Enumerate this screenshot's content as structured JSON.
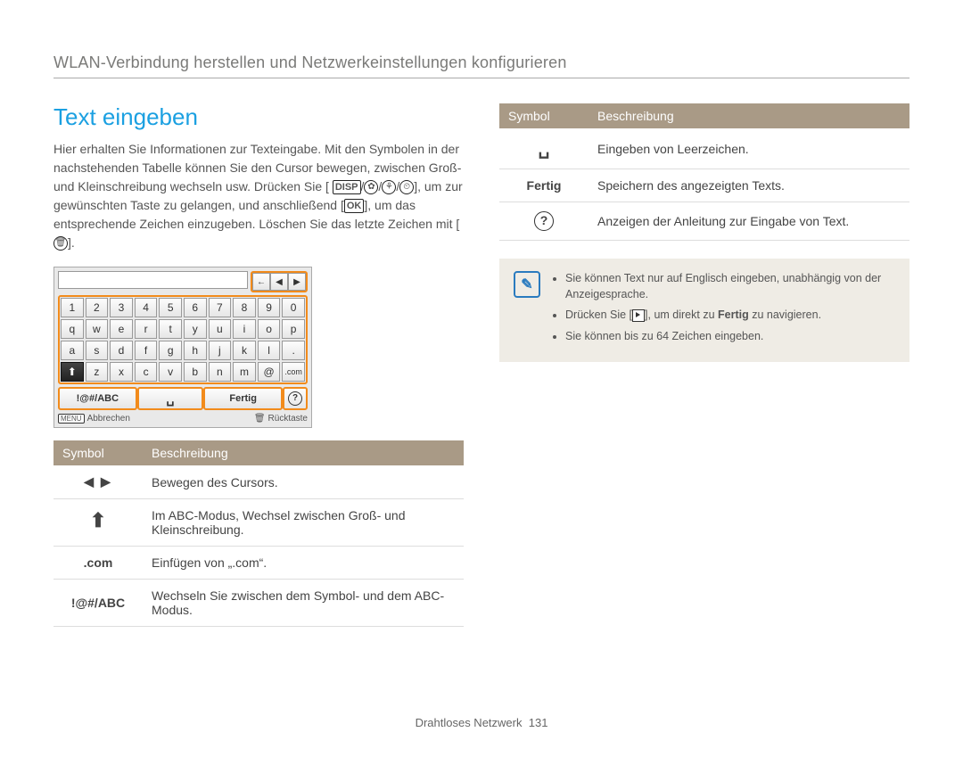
{
  "breadcrumb": "WLAN-Verbindung herstellen und Netzwerkeinstellungen konfigurieren",
  "heading": "Text eingeben",
  "body_before_badges": "Hier erhalten Sie Informationen zur Texteingabe. Mit den Symbolen in der nachstehenden Tabelle können Sie den Cursor bewegen, zwischen Groß- und Kleinschreibung wechseln usw. Drücken Sie [",
  "badge_disp": "DISP",
  "badge_ok": "OK",
  "body_between": "], um zur gewünschten Taste zu gelangen, und anschließend [",
  "body_after": "], um das entsprechende Zeichen einzugeben. Löschen Sie das letzte Zeichen mit [",
  "body_end": "].",
  "keyboard": {
    "nav": {
      "back": "←",
      "left": "◀",
      "right": "▶"
    },
    "row1": [
      "1",
      "2",
      "3",
      "4",
      "5",
      "6",
      "7",
      "8",
      "9",
      "0"
    ],
    "row2": [
      "q",
      "w",
      "e",
      "r",
      "t",
      "y",
      "u",
      "i",
      "o",
      "p"
    ],
    "row3": [
      "a",
      "s",
      "d",
      "f",
      "g",
      "h",
      "j",
      "k",
      "l",
      "."
    ],
    "row4_shift": "⬆",
    "row4": [
      "z",
      "x",
      "c",
      "v",
      "b",
      "n",
      "m",
      "@"
    ],
    "row4_com": ".com",
    "action_abc": "!@#/ABC",
    "action_space": "␣",
    "action_done": "Fertig",
    "action_help": "?",
    "footer_left_badge": "MENU",
    "footer_left": "Abbrechen",
    "footer_right_icon": "🗑",
    "footer_right": "Rücktaste"
  },
  "table_left": {
    "h1": "Symbol",
    "h2": "Beschreibung",
    "rows": [
      {
        "sym_html": "◀ ▶",
        "desc": "Bewegen des Cursors."
      },
      {
        "sym_html": "⬆",
        "desc": "Im ABC-Modus, Wechsel zwischen Groß- und Kleinschreibung."
      },
      {
        "sym_html": ".com",
        "desc": "Einfügen von „.com“."
      },
      {
        "sym_html": "!@#/ABC",
        "desc": "Wechseln Sie zwischen dem Symbol- und dem ABC-Modus."
      }
    ]
  },
  "table_right": {
    "h1": "Symbol",
    "h2": "Beschreibung",
    "rows": [
      {
        "sym_html": "␣",
        "desc": "Eingeben von Leerzeichen."
      },
      {
        "sym_html": "Fertig",
        "desc": "Speichern des angezeigten Texts."
      },
      {
        "sym_html": "?",
        "desc": "Anzeigen der Anleitung zur Eingabe von Text."
      }
    ]
  },
  "info": {
    "icon": "✎",
    "items": [
      "Sie können Text nur auf Englisch eingeben, unabhängig von der Anzeigesprache.",
      {
        "prefix": "Drücken Sie [",
        "suffix_bold": "Fertig",
        "suffix": " zu navigieren.",
        "mid": "], um direkt zu "
      },
      "Sie können bis zu 64 Zeichen eingeben."
    ]
  },
  "footer": {
    "section": "Drahtloses Netzwerk",
    "page": "131"
  }
}
